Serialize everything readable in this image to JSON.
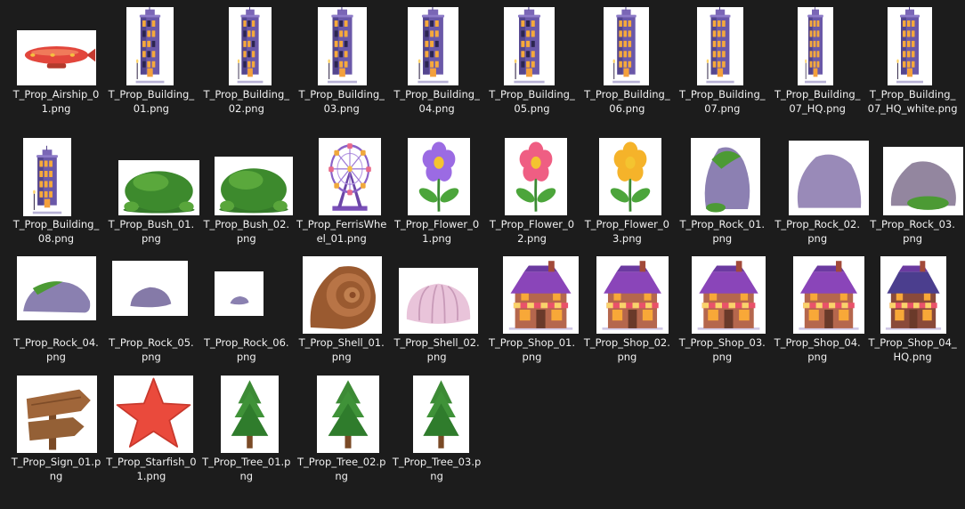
{
  "items": [
    {
      "name": "T_Prop_Airship_01.png",
      "icon": "airship"
    },
    {
      "name": "T_Prop_Building_01.png",
      "icon": "building"
    },
    {
      "name": "T_Prop_Building_02.png",
      "icon": "building"
    },
    {
      "name": "T_Prop_Building_03.png",
      "icon": "building"
    },
    {
      "name": "T_Prop_Building_04.png",
      "icon": "building"
    },
    {
      "name": "T_Prop_Building_05.png",
      "icon": "building"
    },
    {
      "name": "T_Prop_Building_06.png",
      "icon": "building-lit"
    },
    {
      "name": "T_Prop_Building_07.png",
      "icon": "building-lit"
    },
    {
      "name": "T_Prop_Building_07_HQ.png",
      "icon": "building-dark"
    },
    {
      "name": "T_Prop_Building_07_HQ_white.png",
      "icon": "building-lit"
    },
    {
      "name": "T_Prop_Building_08.png",
      "icon": "building-small"
    },
    {
      "name": "T_Prop_Bush_01.png",
      "icon": "bush"
    },
    {
      "name": "T_Prop_Bush_02.png",
      "icon": "bush"
    },
    {
      "name": "T_Prop_FerrisWheel_01.png",
      "icon": "ferris-wheel"
    },
    {
      "name": "T_Prop_Flower_01.png",
      "icon": "flower",
      "color": "#9b6be3"
    },
    {
      "name": "T_Prop_Flower_02.png",
      "icon": "flower",
      "color": "#ef5e83"
    },
    {
      "name": "T_Prop_Flower_03.png",
      "icon": "flower",
      "color": "#f5b32a"
    },
    {
      "name": "T_Prop_Rock_01.png",
      "icon": "rock-tall"
    },
    {
      "name": "T_Prop_Rock_02.png",
      "icon": "rock"
    },
    {
      "name": "T_Prop_Rock_03.png",
      "icon": "rock-moss"
    },
    {
      "name": "T_Prop_Rock_04.png",
      "icon": "rock-flat"
    },
    {
      "name": "T_Prop_Rock_05.png",
      "icon": "rock-small"
    },
    {
      "name": "T_Prop_Rock_06.png",
      "icon": "rock-tiny"
    },
    {
      "name": "T_Prop_Shell_01.png",
      "icon": "shell-spiral"
    },
    {
      "name": "T_Prop_Shell_02.png",
      "icon": "shell-scallop"
    },
    {
      "name": "T_Prop_Shop_01.png",
      "icon": "shop"
    },
    {
      "name": "T_Prop_Shop_02.png",
      "icon": "shop"
    },
    {
      "name": "T_Prop_Shop_03.png",
      "icon": "shop"
    },
    {
      "name": "T_Prop_Shop_04.png",
      "icon": "shop"
    },
    {
      "name": "T_Prop_Shop_04_HQ.png",
      "icon": "shop-dark"
    },
    {
      "name": "T_Prop_Sign_01.png",
      "icon": "sign"
    },
    {
      "name": "T_Prop_Starfish_01.png",
      "icon": "starfish"
    },
    {
      "name": "T_Prop_Tree_01.png",
      "icon": "tree"
    },
    {
      "name": "T_Prop_Tree_02.png",
      "icon": "tree"
    },
    {
      "name": "T_Prop_Tree_03.png",
      "icon": "tree"
    }
  ]
}
